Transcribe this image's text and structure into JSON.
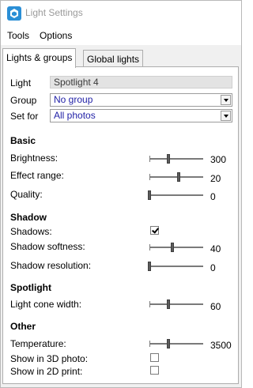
{
  "window": {
    "title": "Light Settings"
  },
  "menu": [
    "Tools",
    "Options"
  ],
  "tabs": {
    "active": "Lights & groups",
    "inactive": "Global lights"
  },
  "fields": {
    "light_label": "Light",
    "light_value": "Spotlight 4",
    "group_label": "Group",
    "group_value": "No group",
    "setfor_label": "Set for",
    "setfor_value": "All photos"
  },
  "sections": {
    "basic": "Basic",
    "shadow": "Shadow",
    "spotlight": "Spotlight",
    "other": "Other"
  },
  "params": {
    "brightness": {
      "label": "Brightness:",
      "value": "300",
      "level": 0.35
    },
    "effect_range": {
      "label": "Effect range:",
      "value": "20",
      "level": 0.55
    },
    "quality": {
      "label": "Quality:",
      "value": "0",
      "level": 0.0
    },
    "shadows": {
      "label": "Shadows:",
      "checked": true
    },
    "shadow_softness": {
      "label": "Shadow softness:",
      "value": "40",
      "level": 0.42
    },
    "shadow_resolution": {
      "label": "Shadow resolution:",
      "value": "0",
      "level": 0.0
    },
    "light_cone_width": {
      "label": "Light cone width:",
      "value": "60",
      "level": 0.35
    },
    "temperature": {
      "label": "Temperature:",
      "value": "3500",
      "level": 0.35
    },
    "show_3d": {
      "label": "Show in 3D photo:",
      "checked": false
    },
    "show_2d": {
      "label": "Show in 2D print:",
      "checked": false
    }
  },
  "colors": {
    "accent": "#1f1fa6",
    "panel_bg": "#f0f0f0",
    "readonly_bg": "#e3e3e3"
  }
}
